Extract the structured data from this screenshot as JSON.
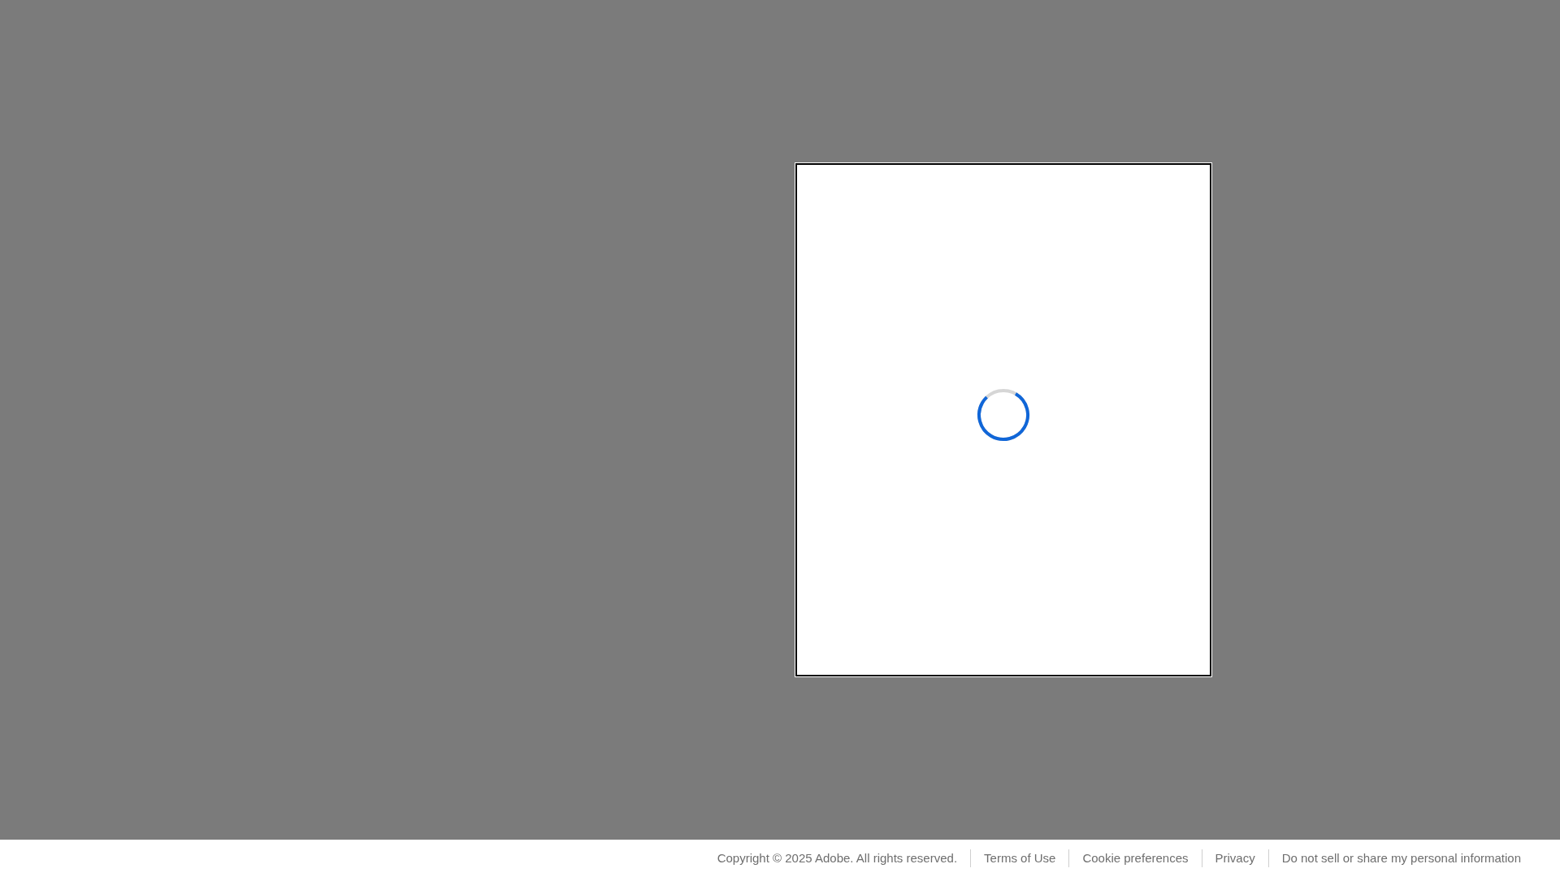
{
  "footer": {
    "copyright": "Copyright © 2025 Adobe. All rights reserved.",
    "links": [
      "Terms of Use",
      "Cookie preferences",
      "Privacy",
      "Do not sell or share my personal information"
    ]
  }
}
